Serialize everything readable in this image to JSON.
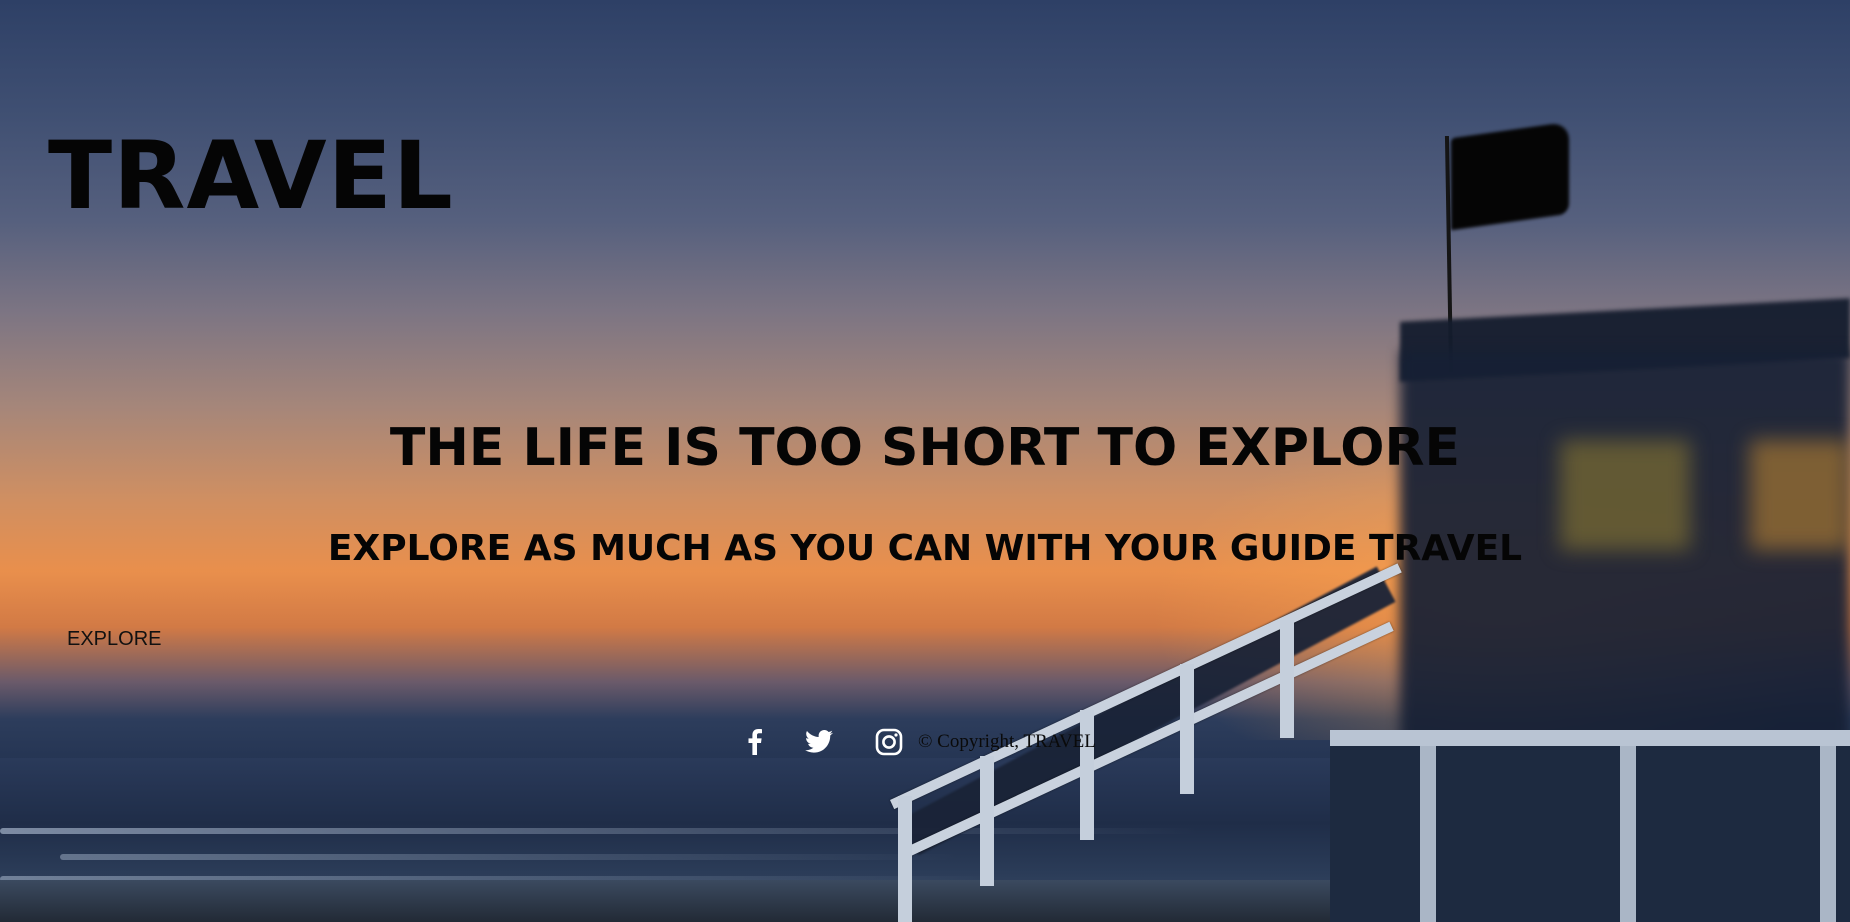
{
  "header": {
    "brand": "TRAVEL"
  },
  "hero": {
    "headline": "THE LIFE IS TOO SHORT TO EXPLORE",
    "subheadline": "EXPLORE AS MUCH AS YOU CAN WITH YOUR GUIDE TRAVEL",
    "cta_label": "EXPLORE"
  },
  "footer": {
    "social": [
      {
        "name": "facebook-icon"
      },
      {
        "name": "twitter-icon"
      },
      {
        "name": "instagram-icon"
      }
    ],
    "copyright": "© Copyright, TRAVEL"
  },
  "colors": {
    "text": "#050505",
    "icon": "#ffffff"
  }
}
